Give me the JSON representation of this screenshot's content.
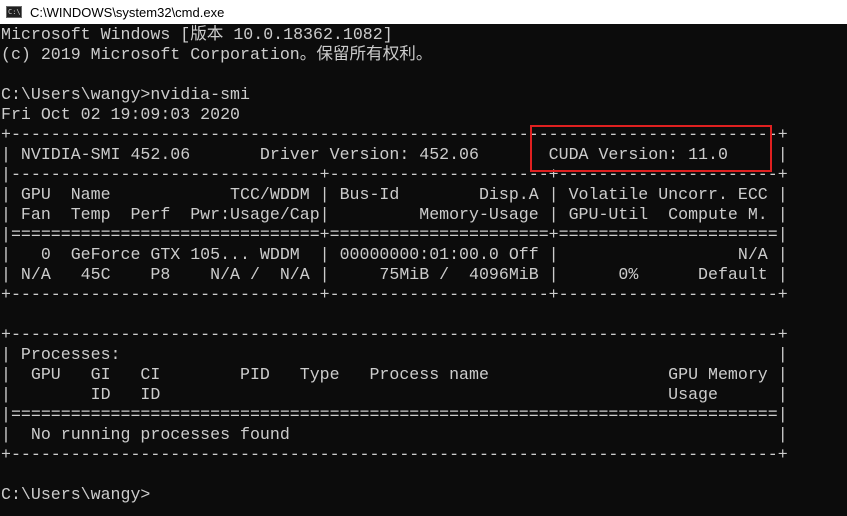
{
  "titlebar": {
    "icon": "cmd-icon",
    "icon_label": "C:\\",
    "title": "C:\\WINDOWS\\system32\\cmd.exe"
  },
  "console": {
    "lines": [
      "Microsoft Windows [版本 10.0.18362.1082]",
      "(c) 2019 Microsoft Corporation。保留所有权利。",
      "",
      "C:\\Users\\wangy>nvidia-smi",
      "Fri Oct 02 19:09:03 2020",
      "+-----------------------------------------------------------------------------+",
      "| NVIDIA-SMI 452.06       Driver Version: 452.06       CUDA Version: 11.0     |",
      "|-------------------------------+----------------------+----------------------+",
      "| GPU  Name            TCC/WDDM | Bus-Id        Disp.A | Volatile Uncorr. ECC |",
      "| Fan  Temp  Perf  Pwr:Usage/Cap|         Memory-Usage | GPU-Util  Compute M. |",
      "|===============================+======================+======================|",
      "|   0  GeForce GTX 105... WDDM  | 00000000:01:00.0 Off |                  N/A |",
      "| N/A   45C    P8    N/A /  N/A |     75MiB /  4096MiB |      0%      Default |",
      "+-------------------------------+----------------------+----------------------+",
      "",
      "+-----------------------------------------------------------------------------+",
      "| Processes:                                                                  |",
      "|  GPU   GI   CI        PID   Type   Process name                  GPU Memory |",
      "|        ID   ID                                                   Usage      |",
      "|=============================================================================|",
      "|  No running processes found                                                 |",
      "+-----------------------------------------------------------------------------+",
      "",
      "C:\\Users\\wangy>"
    ]
  }
}
